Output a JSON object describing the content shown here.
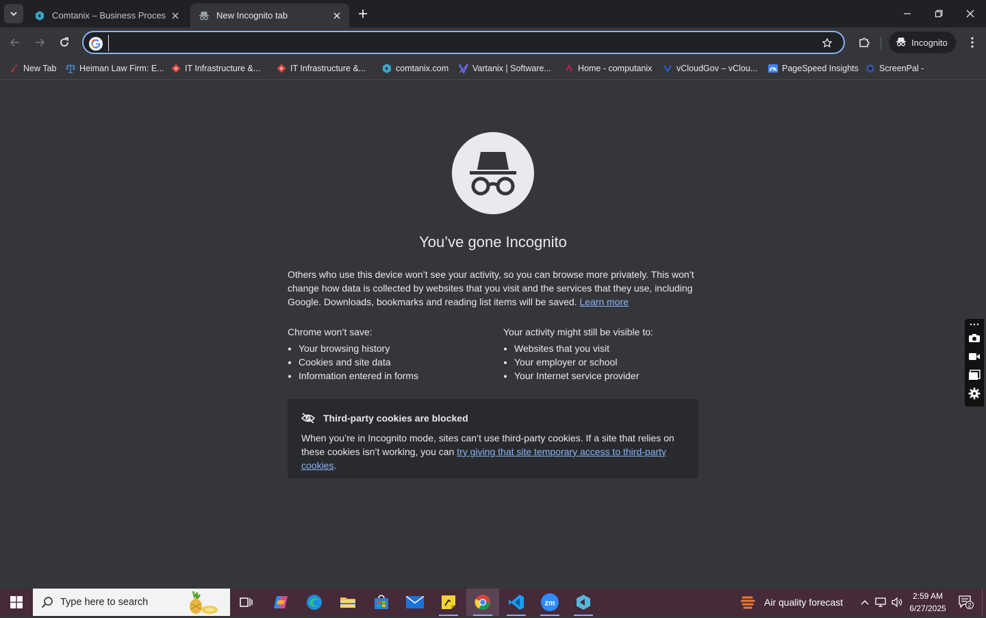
{
  "browser": {
    "tabs": [
      {
        "title": "Comtanix – Business Process Ou",
        "active": false
      },
      {
        "title": "New Incognito tab",
        "active": true
      }
    ],
    "omnibox": {
      "value": "",
      "placeholder": ""
    },
    "profile_label": "Incognito"
  },
  "bookmarks": [
    {
      "label": "New Tab",
      "icon": "feather-icon"
    },
    {
      "label": "Heiman Law Firm: E...",
      "icon": "scales-icon"
    },
    {
      "label": "IT Infrastructure &...",
      "icon": "red-diamond-icon"
    },
    {
      "label": "IT Infrastructure &...",
      "icon": "red-diamond-icon"
    },
    {
      "label": "comtanix.com",
      "icon": "comtanix-icon"
    },
    {
      "label": "Vartanix | Software...",
      "icon": "vartanix-icon"
    },
    {
      "label": "Home - computanix",
      "icon": "computanix-icon"
    },
    {
      "label": "vCloudGov – vClou...",
      "icon": "vcloud-icon"
    },
    {
      "label": "PageSpeed Insights",
      "icon": "pagespeed-icon"
    },
    {
      "label": "ScreenPal -",
      "icon": "screenpal-icon"
    }
  ],
  "page": {
    "headline": "You’ve gone Incognito",
    "intro": "Others who use this device won’t see your activity, so you can browse more privately. This won’t change how data is collected by websites that you visit and the services that they use, including Google. Downloads, bookmarks and reading list items will be saved.",
    "learn_more": "Learn more",
    "wont_save": {
      "heading": "Chrome won’t save:",
      "items": [
        "Your browsing history",
        "Cookies and site data",
        "Information entered in forms"
      ]
    },
    "visible_to": {
      "heading": "Your activity might still be visible to:",
      "items": [
        "Websites that you visit",
        "Your employer or school",
        "Your Internet service provider"
      ]
    },
    "cookies": {
      "title": "Third-party cookies are blocked",
      "body": "When you’re in Incognito mode, sites can’t use third-party cookies. If a site that relies on these cookies isn’t working, you can",
      "link": "try giving that site temporary access to third-party cookies",
      "end": "."
    }
  },
  "taskbar": {
    "search_placeholder": "Type here to search",
    "weather": "Air quality forecast",
    "time": "2:59 AM",
    "date": "6/27/2025",
    "notification_count": "2"
  },
  "colors": {
    "accent": "#8ab4f8",
    "page_bg": "#35363a",
    "tabstrip_bg": "#202124",
    "taskbar_bg": "#452a3a"
  }
}
